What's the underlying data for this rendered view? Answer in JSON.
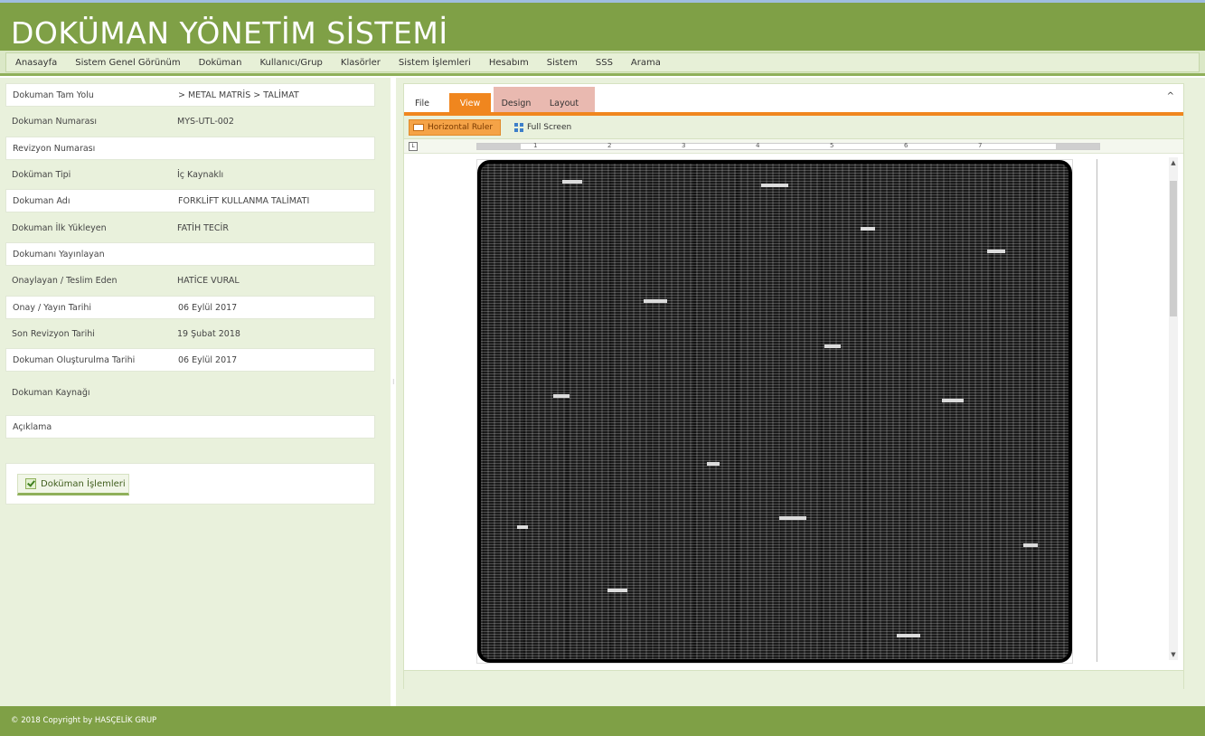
{
  "app": {
    "title": "DOKÜMAN YÖNETİM SİSTEMİ"
  },
  "menu": [
    "Anasayfa",
    "Sistem Genel Görünüm",
    "Doküman",
    "Kullanıcı/Grup",
    "Klasörler",
    "Sistem İşlemleri",
    "Hesabım",
    "Sistem",
    "SSS",
    "Arama"
  ],
  "details": [
    {
      "label": "Dokuman Tam Yolu",
      "value": "> METAL MATRİS > TALİMAT"
    },
    {
      "label": "Dokuman Numarası",
      "value": "MYS-UTL-002"
    },
    {
      "label": "Revizyon Numarası",
      "value": ""
    },
    {
      "label": "Doküman Tipi",
      "value": "İç Kaynaklı"
    },
    {
      "label": "Dokuman Adı",
      "value": "FORKLİFT KULLANMA TALİMATI"
    },
    {
      "label": "Dokuman İlk Yükleyen",
      "value": "FATİH TECİR"
    },
    {
      "label": "Dokumanı Yayınlayan",
      "value": ""
    },
    {
      "label": "Onaylayan / Teslim Eden",
      "value": "HATİCE VURAL"
    },
    {
      "label": "Onay / Yayın Tarihi",
      "value": "06 Eylül 2017"
    },
    {
      "label": "Son Revizyon Tarihi",
      "value": "19 Şubat 2018"
    },
    {
      "label": "Dokuman Oluşturulma Tarihi",
      "value": "06 Eylül 2017"
    },
    {
      "label": "Dokuman Kaynağı",
      "value": ""
    },
    {
      "label": "Açıklama",
      "value": ""
    }
  ],
  "operations_button": "Doküman İşlemleri",
  "ribbon": {
    "tabs": {
      "file": "File",
      "view": "View",
      "design": "Design",
      "layout": "Layout"
    },
    "collapse": "^",
    "buttons": {
      "horizontal_ruler": "Horizontal Ruler",
      "full_screen": "Full Screen"
    },
    "ruler_corner": "L",
    "ruler_numbers": [
      "1",
      "2",
      "3",
      "4",
      "5",
      "6",
      "7"
    ]
  },
  "scroll": {
    "up": "▲",
    "down": "▼"
  },
  "splitter": "⁝",
  "footer": {
    "copyright": "© 2018 Copyright by HASÇELİK GRUP"
  },
  "colors": {
    "brand_green": "#7fa046",
    "accent_orange": "#f0861e",
    "panel_bg": "#e9f1dc"
  }
}
